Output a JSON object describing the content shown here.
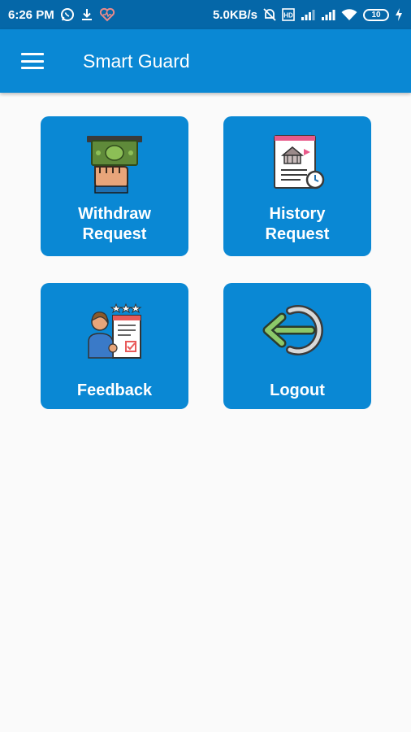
{
  "status_bar": {
    "time": "6:26 PM",
    "net_speed": "5.0KB/s",
    "battery": "10"
  },
  "app_bar": {
    "title": "Smart Guard",
    "menu_icon": "hamburger-menu-icon"
  },
  "menu": {
    "withdraw": {
      "line1": "Withdraw",
      "line2": "Request",
      "icon": "cash-withdraw-icon"
    },
    "history": {
      "line1": "History",
      "line2": "Request",
      "icon": "bank-history-icon"
    },
    "feedback": {
      "label": "Feedback",
      "icon": "feedback-form-icon"
    },
    "logout": {
      "label": "Logout",
      "icon": "logout-arrow-icon"
    }
  },
  "colors": {
    "status_bar": "#0567a8",
    "primary": "#0a88d4",
    "background": "#fafafa"
  }
}
